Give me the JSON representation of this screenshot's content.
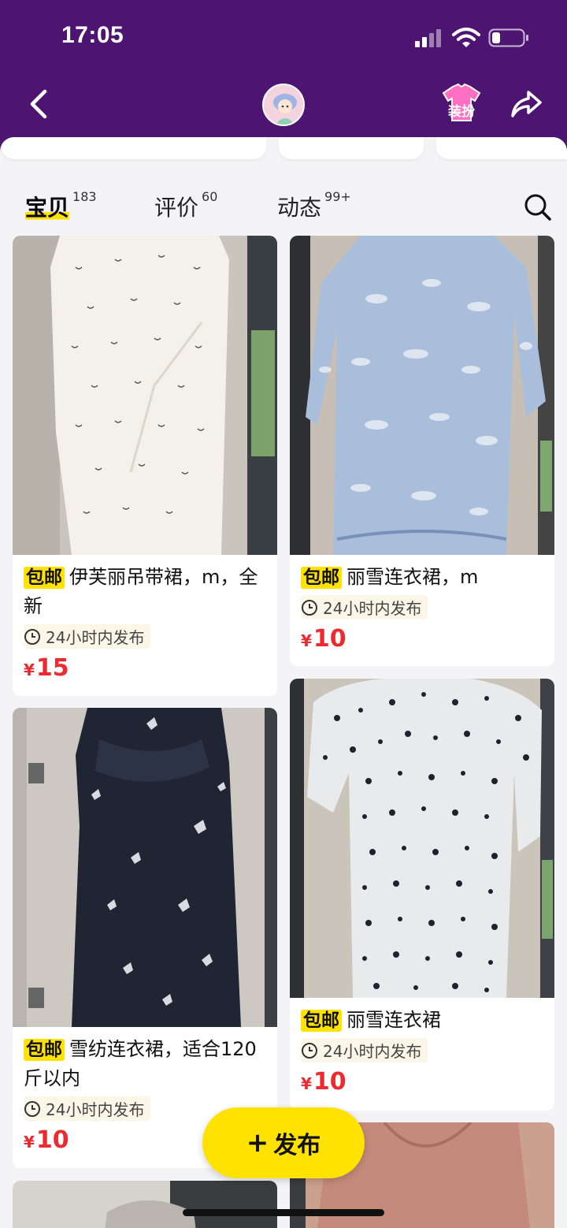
{
  "status_bar": {
    "time": "17:05"
  },
  "header": {
    "dress_up_label": "装扮"
  },
  "tabs": [
    {
      "label": "宝贝",
      "count": "183"
    },
    {
      "label": "评价",
      "count": "60"
    },
    {
      "label": "动态",
      "count": "99+"
    }
  ],
  "products": [
    {
      "badge": "包邮",
      "title": "伊芙丽吊带裙，m，全新",
      "time_tag": "24小时内发布",
      "currency": "¥",
      "price": "15"
    },
    {
      "badge": "包邮",
      "title": "丽雪连衣裙，m",
      "time_tag": "24小时内发布",
      "currency": "¥",
      "price": "10"
    },
    {
      "badge": "包邮",
      "title": "雪纺连衣裙，适合120斤以内",
      "time_tag": "24小时内发布",
      "currency": "¥",
      "price": "10"
    },
    {
      "badge": "包邮",
      "title": "丽雪连衣裙",
      "time_tag": "24小时内发布",
      "currency": "¥",
      "price": "10"
    }
  ],
  "fab": {
    "plus": "+",
    "label": "发布"
  },
  "colors": {
    "header_bg": "#4d1472",
    "accent_yellow": "#ffe200",
    "price_red": "#ec2b31"
  }
}
